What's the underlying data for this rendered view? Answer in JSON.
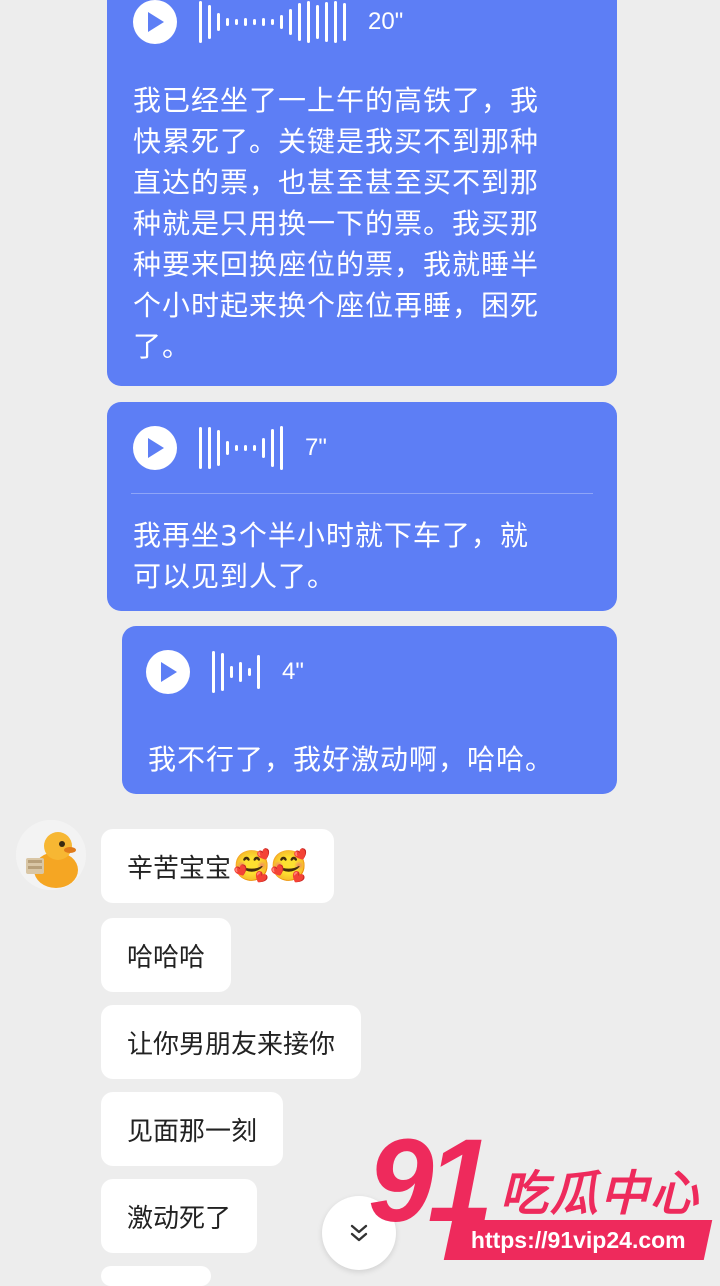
{
  "messages_out": [
    {
      "duration": "20\"",
      "text_lines": [
        "我已经坐了一上午的高铁了，我",
        "快累死了。关键是我买不到那种",
        "直达的票，也甚至甚至买不到那",
        "种就是只用换一下的票。我买那",
        "种要来回换座位的票，我就睡半",
        "个小时起来换个座位再睡，困死",
        "了。"
      ]
    },
    {
      "duration": "7\"",
      "text_lines": [
        "我再坐3个半小时就下车了，就",
        "可以见到人了。"
      ]
    },
    {
      "duration": "4\"",
      "text_lines": [
        "我不行了，我好激动啊，哈哈。"
      ]
    }
  ],
  "messages_in": [
    {
      "text": "辛苦宝宝",
      "emoji": "🥰🥰"
    },
    {
      "text": "哈哈哈"
    },
    {
      "text": "让你男朋友来接你"
    },
    {
      "text": "见面那一刻"
    },
    {
      "text": "激动死了"
    }
  ],
  "watermark": {
    "number": "91",
    "brand": "吃瓜中心",
    "url": "https://91vip24.com",
    "color": "#ee2a5c"
  },
  "colors": {
    "outgoing_bubble": "#5d7ef5",
    "incoming_bubble": "#ffffff",
    "background": "#ededed"
  }
}
